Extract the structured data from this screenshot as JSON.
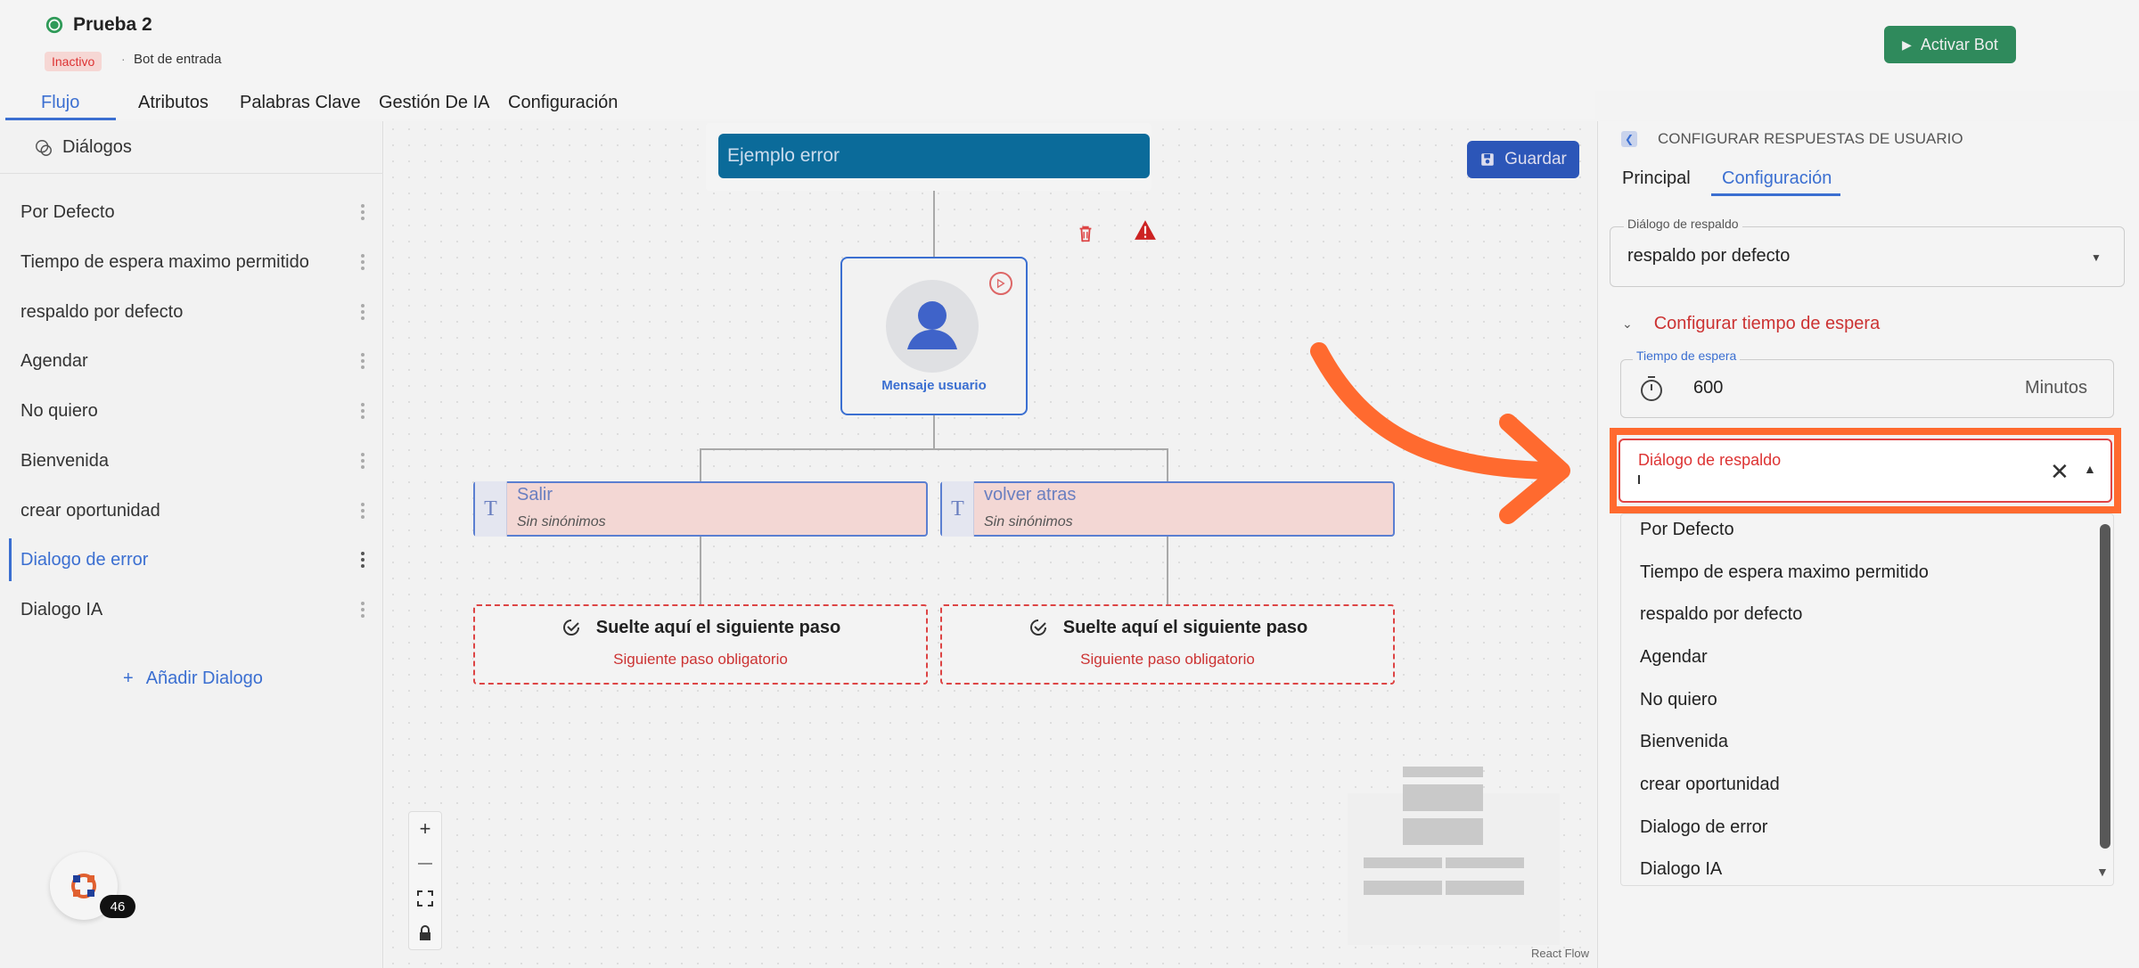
{
  "header": {
    "title": "Prueba 2",
    "status": "Inactivo",
    "separator": "·",
    "bot_type": "Bot de entrada",
    "activate_label": "Activar Bot"
  },
  "tabs": [
    {
      "label": "Flujo",
      "active": true
    },
    {
      "label": "Atributos"
    },
    {
      "label": "Palabras Clave"
    },
    {
      "label": "Gestión De IA"
    },
    {
      "label": "Configuración"
    }
  ],
  "sidebar": {
    "header": "Diálogos",
    "items": [
      {
        "label": "Por Defecto"
      },
      {
        "label": "Tiempo de espera maximo permitido"
      },
      {
        "label": "respaldo por defecto"
      },
      {
        "label": "Agendar"
      },
      {
        "label": "No quiero"
      },
      {
        "label": "Bienvenida"
      },
      {
        "label": "crear oportunidad"
      },
      {
        "label": "Dialogo de error",
        "active": true
      },
      {
        "label": "Dialogo IA"
      }
    ],
    "add_label": "Añadir Dialogo",
    "add_symbol": "+"
  },
  "canvas": {
    "node_title": "Ejemplo error",
    "save_label": "Guardar",
    "user_node_label": "Mensaje usuario",
    "options": [
      {
        "title": "Salir",
        "subtitle": "Sin sinónimos",
        "icon": "T"
      },
      {
        "title": "volver atras",
        "subtitle": "Sin sinónimos",
        "icon": "T"
      }
    ],
    "drop_zones": [
      {
        "title": "Suelte aquí el siguiente paso",
        "subtitle": "Siguiente paso obligatorio"
      },
      {
        "title": "Suelte aquí el siguiente paso",
        "subtitle": "Siguiente paso obligatorio"
      }
    ],
    "zoom_in": "+",
    "zoom_out": "—",
    "attribution": "React Flow",
    "fab_count": "46"
  },
  "panel": {
    "title": "CONFIGURAR RESPUESTAS DE USUARIO",
    "tabs": [
      {
        "label": "Principal"
      },
      {
        "label": "Configuración",
        "active": true
      }
    ],
    "fallback_label": "Diálogo de respaldo",
    "fallback_value": "respaldo por defecto",
    "timeout_section": "Configurar tiempo de espera",
    "timeout_label": "Tiempo de espera",
    "timeout_value": "600",
    "timeout_unit": "Minutos",
    "autocomplete_label": "Diálogo de respaldo",
    "options": [
      "Por Defecto",
      "Tiempo de espera maximo permitido",
      "respaldo por defecto",
      "Agendar",
      "No quiero",
      "Bienvenida",
      "crear oportunidad",
      "Dialogo de error",
      "Dialogo IA"
    ]
  },
  "colors": {
    "accent": "#3b6fd1",
    "highlight": "#ff6a2f",
    "danger": "#d33333",
    "success": "#2f8a5c"
  }
}
